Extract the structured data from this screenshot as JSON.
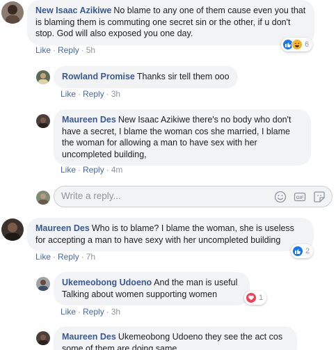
{
  "comments": [
    {
      "name": "New Isaac Azikiwe",
      "text": "No blame to any one of them cause even you that is blaming them is commuting one secret sin or the other, if u don't stop. God will also exposed you one day.",
      "like": "Like",
      "reply": "Reply",
      "time": "5h",
      "reaction_count": "6"
    },
    {
      "name": "Rowland Promise",
      "text": "Thanks sir tell them ooo",
      "like": "Like",
      "reply": "Reply",
      "time": "3h"
    },
    {
      "name": "Maureen Des",
      "text": "New Isaac Azikiwe there's no body who don't have a secret, I blame the woman cos she married, I blame the woman for allowing a man to have sex with her uncompleted building,",
      "like": "Like",
      "reply": "Reply",
      "time": "4m"
    },
    {
      "name": "Maureen Des",
      "text": "Who is to blame? I blame the woman, she is useless for accepting a man to have sexy with her uncompleted building",
      "like": "Like",
      "reply": "Reply",
      "time": "7h",
      "reaction_count": "2"
    },
    {
      "name": "Ukemeobong Udoeno",
      "text": "And the man is useful Talking about women supporting women",
      "like": "Like",
      "reply": "Reply",
      "time": "3h",
      "reaction_count": "1"
    },
    {
      "name": "Maureen Des",
      "text": "Ukemeobong Udoeno they see the act cos some of them are doing same"
    }
  ],
  "reply_box": {
    "placeholder": "Write a reply..."
  },
  "colors": {
    "link": "#4267b2",
    "name": "#385898",
    "bubble": "#f2f3f5",
    "like_blue": "#1877f2",
    "love_red": "#f33e58",
    "haha_yellow": "#f7b125"
  },
  "icons": [
    "like-reaction-icon",
    "haha-reaction-icon",
    "love-reaction-icon",
    "emoji-icon",
    "gif-icon",
    "sticker-icon"
  ]
}
